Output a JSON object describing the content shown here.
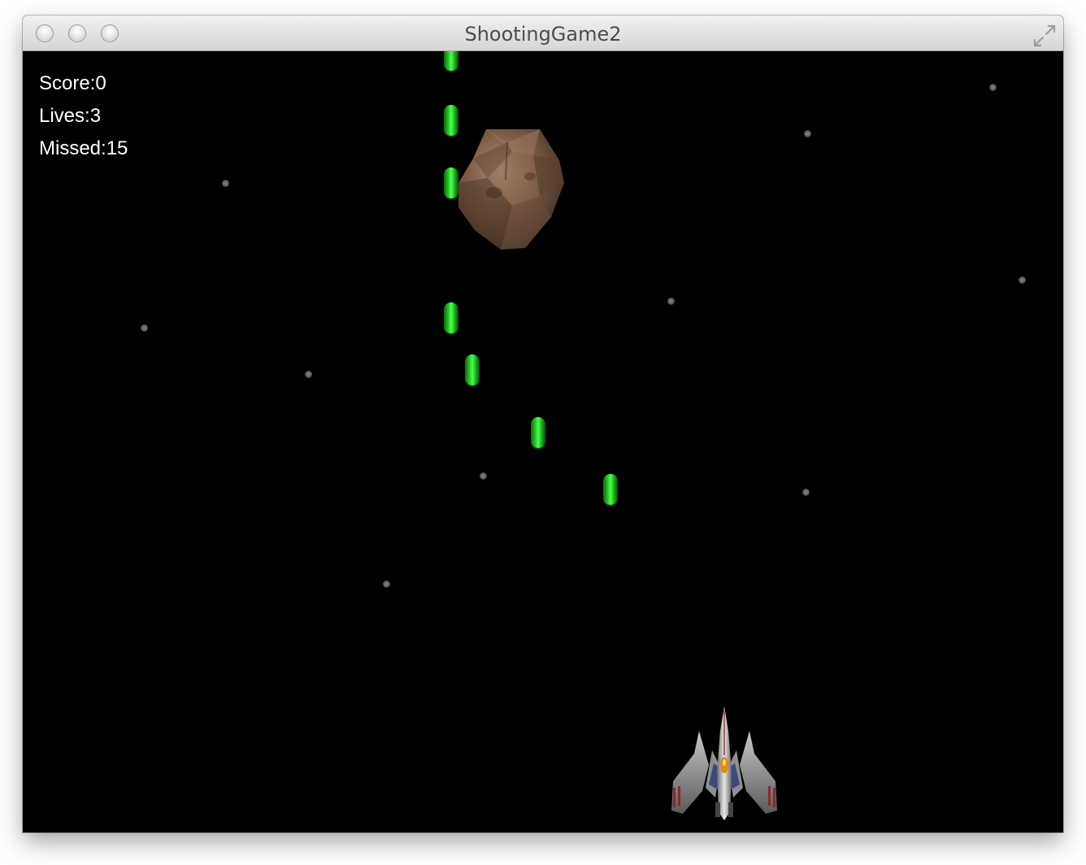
{
  "window": {
    "title": "ShootingGame2"
  },
  "hud": {
    "score": "Score:0",
    "lives": "Lives:3",
    "missed": "Missed:15"
  },
  "colors": {
    "background": "#000000",
    "bullet": "#22c522",
    "hud_text": "#ffffff",
    "star": "#6e6e6e",
    "asteroid": "#7a5a44"
  },
  "icons": {
    "close": "close-button-icon",
    "minimize": "minimize-button-icon",
    "zoom": "zoom-button-icon",
    "fullscreen": "fullscreen-arrows-icon"
  }
}
